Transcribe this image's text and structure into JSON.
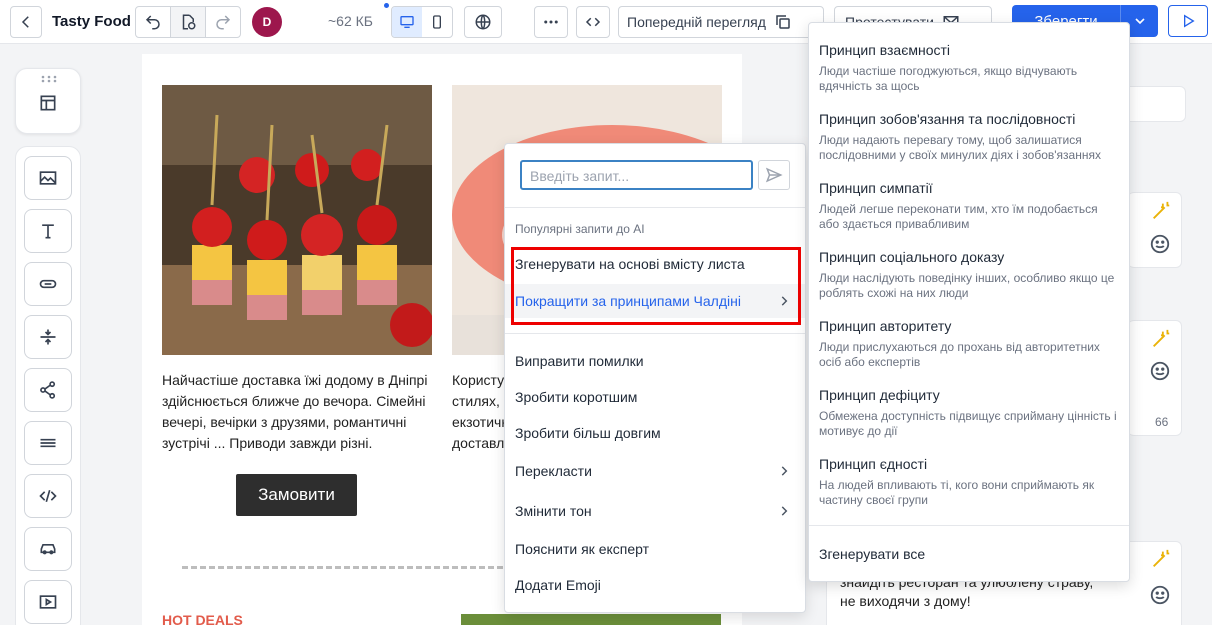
{
  "header": {
    "brand": "Tasty Food",
    "size": "~62 КБ",
    "avatar_letter": "D",
    "preview_label": "Попередній перегляд",
    "test_label": "Протестувати",
    "save_label": "Зберегти"
  },
  "email": {
    "desc_left": "Найчастіше доставка їжі додому в Дніпрі здійснюється ближче до вечора. Сімейні вечері, вечірки з друзями, романтичні зустрічі ... Приводи завжди різні.",
    "desc_right_lines": [
      "Користу",
      "стилях,",
      "екзотичн",
      "доставл"
    ],
    "order_button": "Замовити",
    "hot_deals": "HOT DEALS"
  },
  "right_panel": {
    "text_line1": "знайдіть ресторан та улюблену страву,",
    "text_line2": "не виходячи з дому!",
    "count": "66"
  },
  "ai_menu": {
    "input_placeholder": "Введіть запит...",
    "popular_caption": "Популярні запити до AI",
    "items": [
      {
        "label": "Згенерувати на основі вмісту листа"
      },
      {
        "label": "Покращити за принципами Чалдіні"
      },
      {
        "label": "Виправити помилки"
      },
      {
        "label": "Зробити коротшим"
      },
      {
        "label": "Зробити більш довгим"
      },
      {
        "label": "Перекласти"
      },
      {
        "label": "Змінити тон"
      },
      {
        "label": "Пояснити як експерт"
      },
      {
        "label": "Додати Emoji"
      }
    ]
  },
  "cialdini_menu": {
    "principles": [
      {
        "title": "Принцип взаємності",
        "desc": "Люди частіше погоджуються, якщо відчувають вдячність за щось"
      },
      {
        "title": "Принцип зобов'язання та послідовності",
        "desc": "Люди надають перевагу тому, щоб залишатися послідовними у своїх минулих діях і зобов'язаннях"
      },
      {
        "title": "Принцип симпатії",
        "desc": "Людей легше переконати тим, хто їм подобається або здається привабливим"
      },
      {
        "title": "Принцип соціального доказу",
        "desc": "Люди наслідують поведінку інших, особливо якщо це роблять схожі на них люди"
      },
      {
        "title": "Принцип авторитету",
        "desc": "Люди прислухаються до прохань від авторитетних осіб або експертів"
      },
      {
        "title": "Принцип дефіциту",
        "desc": "Обмежена доступність підвищує сприйману цінність і мотивує до дії"
      },
      {
        "title": "Принцип єдності",
        "desc": "На людей впливають ті, кого вони сприймають як частину своєї групи"
      }
    ],
    "generate_all": "Згенерувати все"
  }
}
